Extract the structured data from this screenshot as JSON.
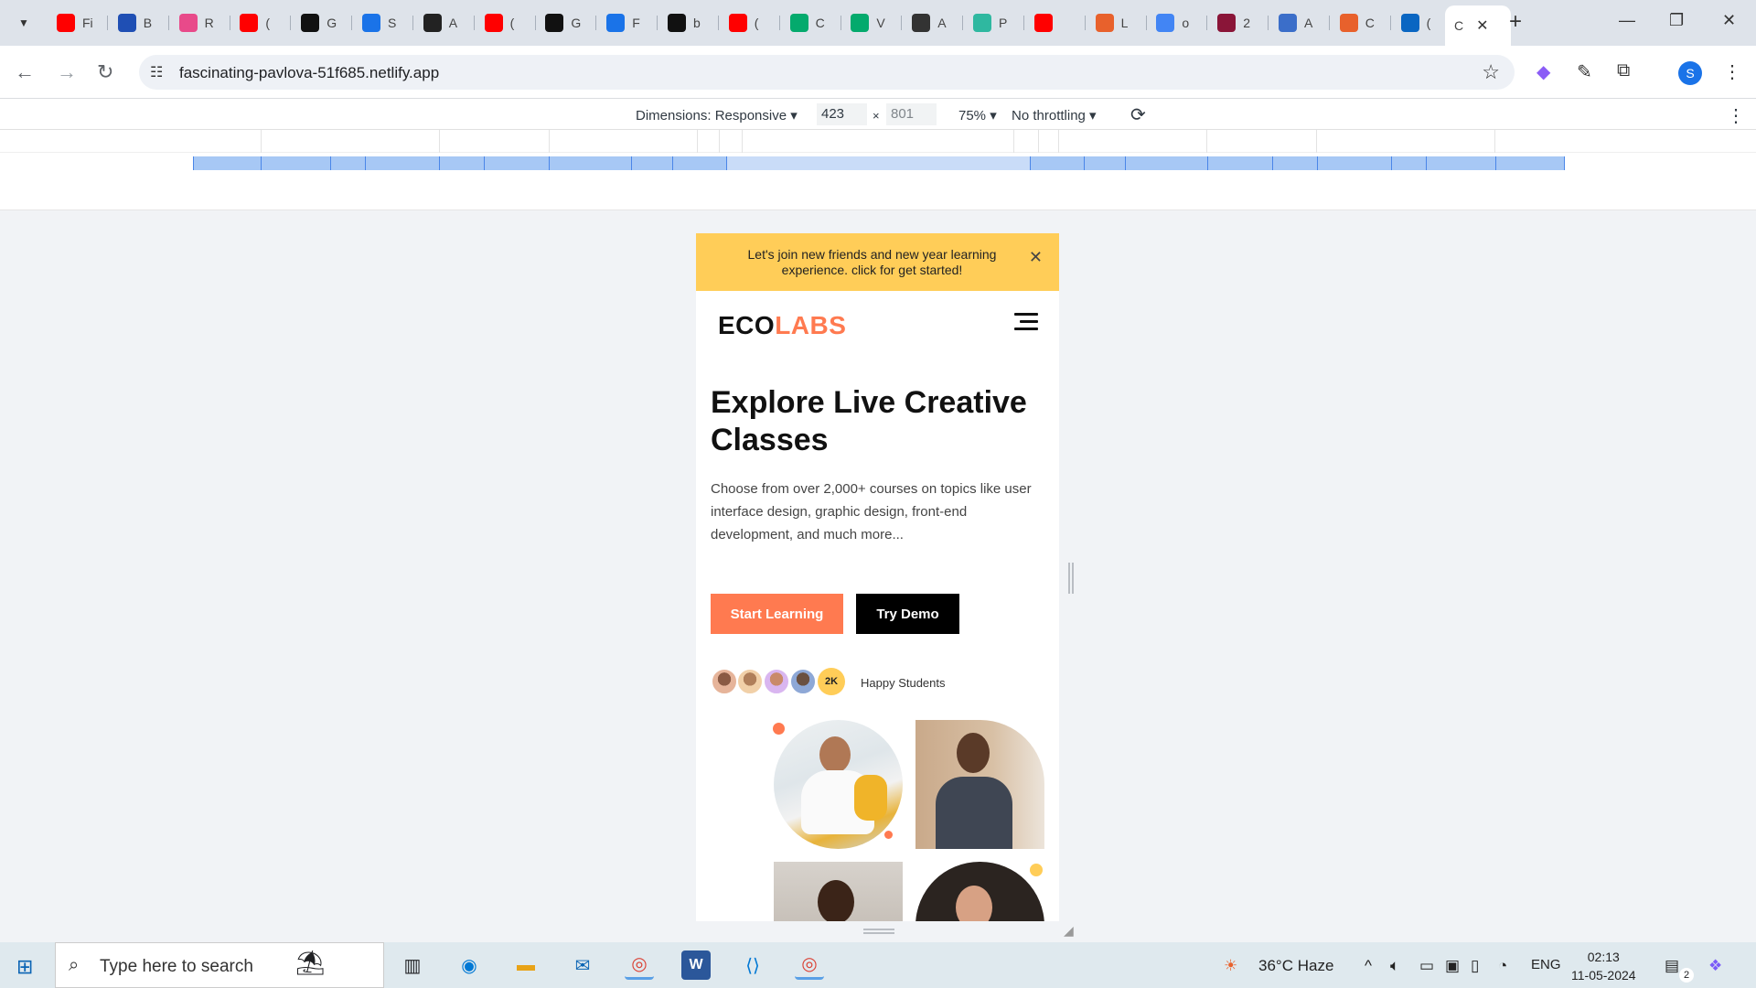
{
  "browser": {
    "tabs": [
      {
        "letter": "Fi",
        "icon": "youtube-icon",
        "color": "#ff0000"
      },
      {
        "letter": "B",
        "icon": "star-app-icon",
        "color": "#1f4fb4"
      },
      {
        "letter": "R",
        "icon": "react-flower-icon",
        "color": "#e84a8a"
      },
      {
        "letter": "(",
        "icon": "youtube-icon",
        "color": "#ff0000"
      },
      {
        "letter": "G",
        "icon": "github-icon",
        "color": "#111111"
      },
      {
        "letter": "S",
        "icon": "s-logo-icon",
        "color": "#1a73e8"
      },
      {
        "letter": "A",
        "icon": "react-atom-icon",
        "color": "#222222"
      },
      {
        "letter": "(",
        "icon": "youtube-icon",
        "color": "#ff0000"
      },
      {
        "letter": "G",
        "icon": "github-icon",
        "color": "#111111"
      },
      {
        "letter": "F",
        "icon": "flag-icon",
        "color": "#1a73e8"
      },
      {
        "letter": "b",
        "icon": "medium-m-icon",
        "color": "#111111"
      },
      {
        "letter": "(",
        "icon": "youtube-icon",
        "color": "#ff0000"
      },
      {
        "letter": "C",
        "icon": "w-green-icon",
        "color": "#04aa6d"
      },
      {
        "letter": "V",
        "icon": "w-green-icon",
        "color": "#04aa6d"
      },
      {
        "letter": "A",
        "icon": "a-circle-icon",
        "color": "#333333"
      },
      {
        "letter": "P",
        "icon": "copilot-icon",
        "color": "#2fb8a0"
      },
      {
        "letter": "",
        "icon": "youtube-music-icon",
        "color": "#ff0000"
      },
      {
        "letter": "L",
        "icon": "hand-icon",
        "color": "#e8612c"
      },
      {
        "letter": "o",
        "icon": "google-icon",
        "color": "#4285f4"
      },
      {
        "letter": "2",
        "icon": "pw-icon",
        "color": "#8a1538"
      },
      {
        "letter": "A",
        "icon": "shield-icon",
        "color": "#3b6ec9"
      },
      {
        "letter": "C",
        "icon": "figure-icon",
        "color": "#e8612c"
      },
      {
        "letter": "(",
        "icon": "linkedin-icon",
        "color": "#0a66c2"
      }
    ],
    "active_tab_letter": "C",
    "url": "fascinating-pavlova-51f685.netlify.app",
    "profile_initial": "S"
  },
  "devtools": {
    "dimensions_label": "Dimensions: Responsive ▾",
    "width": "423",
    "times": "×",
    "height": "801",
    "zoom": "75% ▾",
    "throttling": "No throttling ▾"
  },
  "site": {
    "promo_text": "Let's join new friends and new year learning experience. click for get started!",
    "logo_eco": "ECO",
    "logo_labs": "LABS",
    "heading": "Explore Live Creative Classes",
    "description": "Choose from over 2,000+ courses on topics like user interface design, graphic design, front-end development, and much more...",
    "btn_start": "Start Learning",
    "btn_demo": "Try Demo",
    "student_count": "2K",
    "students_label": "Happy Students",
    "colors": {
      "accent": "#ff7a50",
      "promo_bg": "#ffcd58",
      "dark": "#000000"
    }
  },
  "taskbar": {
    "search_placeholder": "Type here to search",
    "weather": "36°C  Haze",
    "language": "ENG",
    "time": "02:13",
    "date": "11-05-2024",
    "notification_count": "2"
  }
}
